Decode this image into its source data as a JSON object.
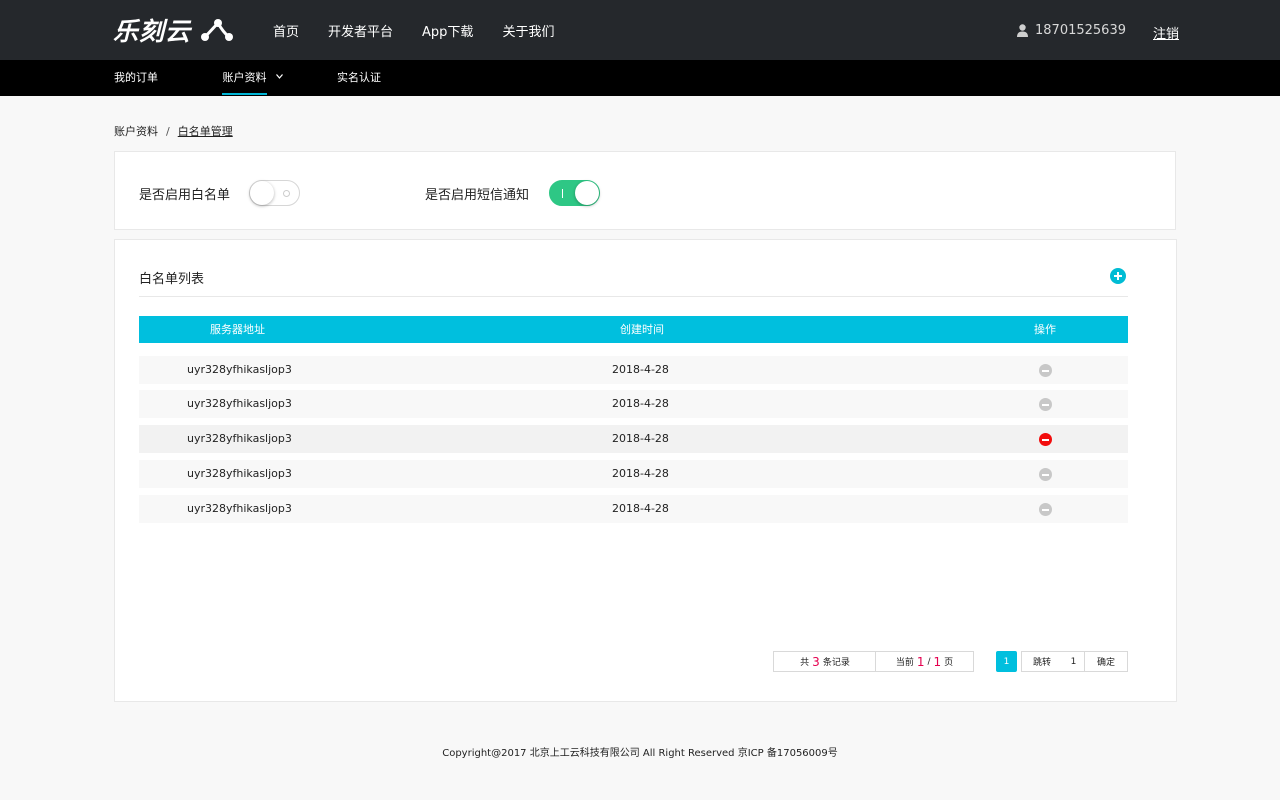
{
  "brand": {
    "logo_text": "乐刻云"
  },
  "nav": {
    "items": [
      "首页",
      "开发者平台",
      "App下载",
      "关于我们"
    ]
  },
  "user": {
    "phone": "18701525639",
    "logout_label": "注销"
  },
  "subnav": {
    "orders": "我的订单",
    "account": "账户资料",
    "verify": "实名认证"
  },
  "breadcrumb": {
    "parent": "账户资料",
    "separator": "/",
    "current": "白名单管理"
  },
  "settings": {
    "whitelist_label": "是否启用白名单",
    "whitelist_enabled": false,
    "sms_label": "是否启用短信通知",
    "sms_enabled": true
  },
  "list": {
    "title": "白名单列表",
    "columns": [
      "服务器地址",
      "创建时间",
      "操作"
    ],
    "rows": [
      {
        "address": "uyr328yfhikasljop3",
        "created": "2018-4-28",
        "hover": false
      },
      {
        "address": "uyr328yfhikasljop3",
        "created": "2018-4-28",
        "hover": false
      },
      {
        "address": "uyr328yfhikasljop3",
        "created": "2018-4-28",
        "hover": true
      },
      {
        "address": "uyr328yfhikasljop3",
        "created": "2018-4-28",
        "hover": false
      },
      {
        "address": "uyr328yfhikasljop3",
        "created": "2018-4-28",
        "hover": false
      }
    ]
  },
  "pagination": {
    "total_prefix": "共",
    "total": "3",
    "total_suffix": "条记录",
    "current_prefix": "当前",
    "current_page": "1",
    "slash": "/",
    "total_pages": "1",
    "current_suffix": "页",
    "active_page": "1",
    "jump_label": "跳转",
    "jump_value": "1",
    "confirm_label": "确定"
  },
  "footer": {
    "text": "Copyright@2017  北京上工云科技有限公司  All Right Reserved   京ICP   备17056009号"
  },
  "colors": {
    "accent": "#00bfde",
    "toggle_on": "#2ec785",
    "danger": "#f20d0d",
    "highlight": "#e5004f"
  }
}
